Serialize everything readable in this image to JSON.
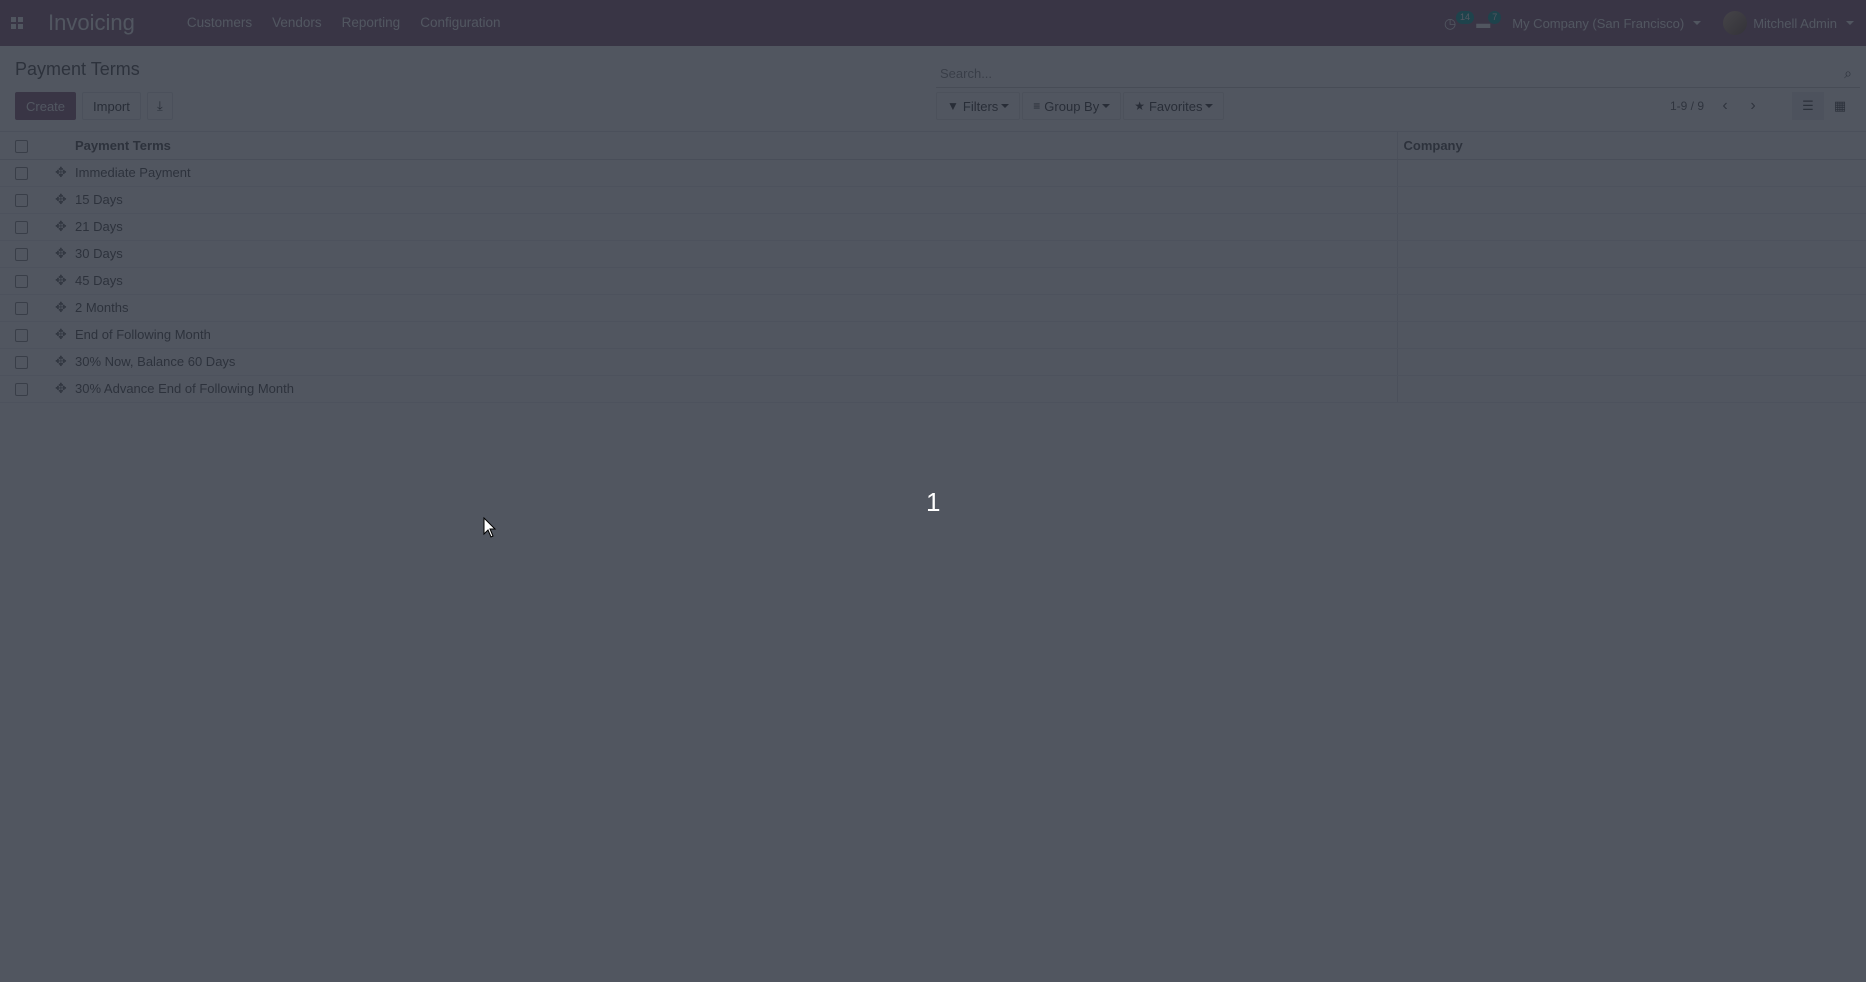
{
  "navbar": {
    "brand": "Invoicing",
    "menu": [
      "Customers",
      "Vendors",
      "Reporting",
      "Configuration"
    ],
    "activity_count": "14",
    "message_count": "7",
    "company": "My Company (San Francisco)",
    "user": "Mitchell Admin"
  },
  "control_panel": {
    "breadcrumb": "Payment Terms",
    "search_placeholder": "Search...",
    "create_label": "Create",
    "import_label": "Import",
    "filters_label": "Filters",
    "groupby_label": "Group By",
    "favorites_label": "Favorites",
    "pager_value": "1-9 / 9"
  },
  "table": {
    "headers": [
      "Payment Terms",
      "Company"
    ],
    "rows": [
      {
        "name": "Immediate Payment",
        "company": ""
      },
      {
        "name": "15 Days",
        "company": ""
      },
      {
        "name": "21 Days",
        "company": ""
      },
      {
        "name": "30 Days",
        "company": ""
      },
      {
        "name": "45 Days",
        "company": ""
      },
      {
        "name": "2 Months",
        "company": ""
      },
      {
        "name": "End of Following Month",
        "company": ""
      },
      {
        "name": "30% Now, Balance 60 Days",
        "company": ""
      },
      {
        "name": "30% Advance End of Following Month",
        "company": ""
      }
    ]
  },
  "overlay": {
    "number": "1"
  },
  "colors": {
    "brand": "#875a7b",
    "overlay": "#262c38"
  }
}
